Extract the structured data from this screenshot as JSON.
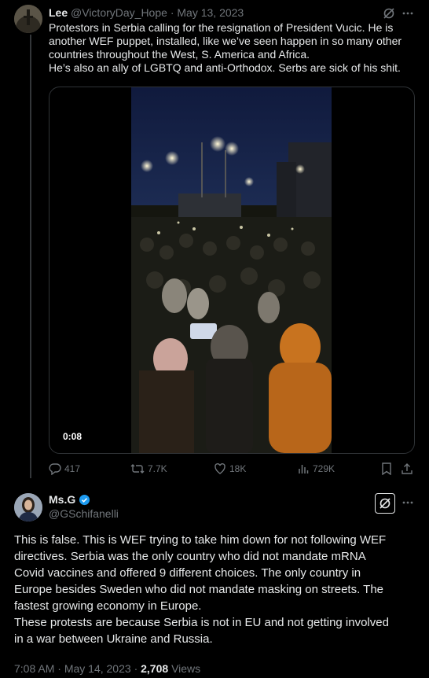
{
  "quoted": {
    "display_name": "Lee",
    "handle": "@VictoryDay_Hope",
    "separator": "·",
    "date": "May 13, 2023",
    "text_lines": [
      "Protestors in Serbia calling for the resignation of President Vucic. He is",
      "another WEF puppet, installed, like we’ve seen happen in so many other",
      "countries throughout the West, S. America and Africa.",
      "He’s also an ally of LGBTQ and anti-Orthodox. Serbs are sick of his shit."
    ],
    "video": {
      "duration": "0:08"
    },
    "metrics": {
      "replies": "417",
      "reposts": "7.7K",
      "likes": "18K",
      "views": "729K"
    }
  },
  "main": {
    "display_name": "Ms.G",
    "handle": "@GSchifanelli",
    "text_lines": [
      "This is false. This is WEF trying to take him down for not following WEF",
      "directives. Serbia was the only country who did not mandate mRNA",
      "Covid vaccines and offered 9 different choices. The only country in",
      "Europe besides Sweden who did not mandate masking on streets. The",
      "fastest growing economy in Europe.",
      "These protests are because Serbia is not in EU and not getting involved",
      "in a war between Ukraine and Russia."
    ],
    "time": "7:08 AM",
    "separator": "·",
    "date": "May 14, 2023",
    "separator2": "·",
    "views_count": "2,708",
    "views_label": "Views"
  },
  "colors": {
    "verified": "#1d9bf0",
    "muted": "#71767b",
    "text": "#e7e9ea",
    "background": "#000000"
  },
  "icons": [
    "grok-icon",
    "more-icon",
    "reply-icon",
    "repost-icon",
    "like-icon",
    "views-icon",
    "bookmark-icon",
    "share-icon",
    "verified-badge-icon"
  ]
}
